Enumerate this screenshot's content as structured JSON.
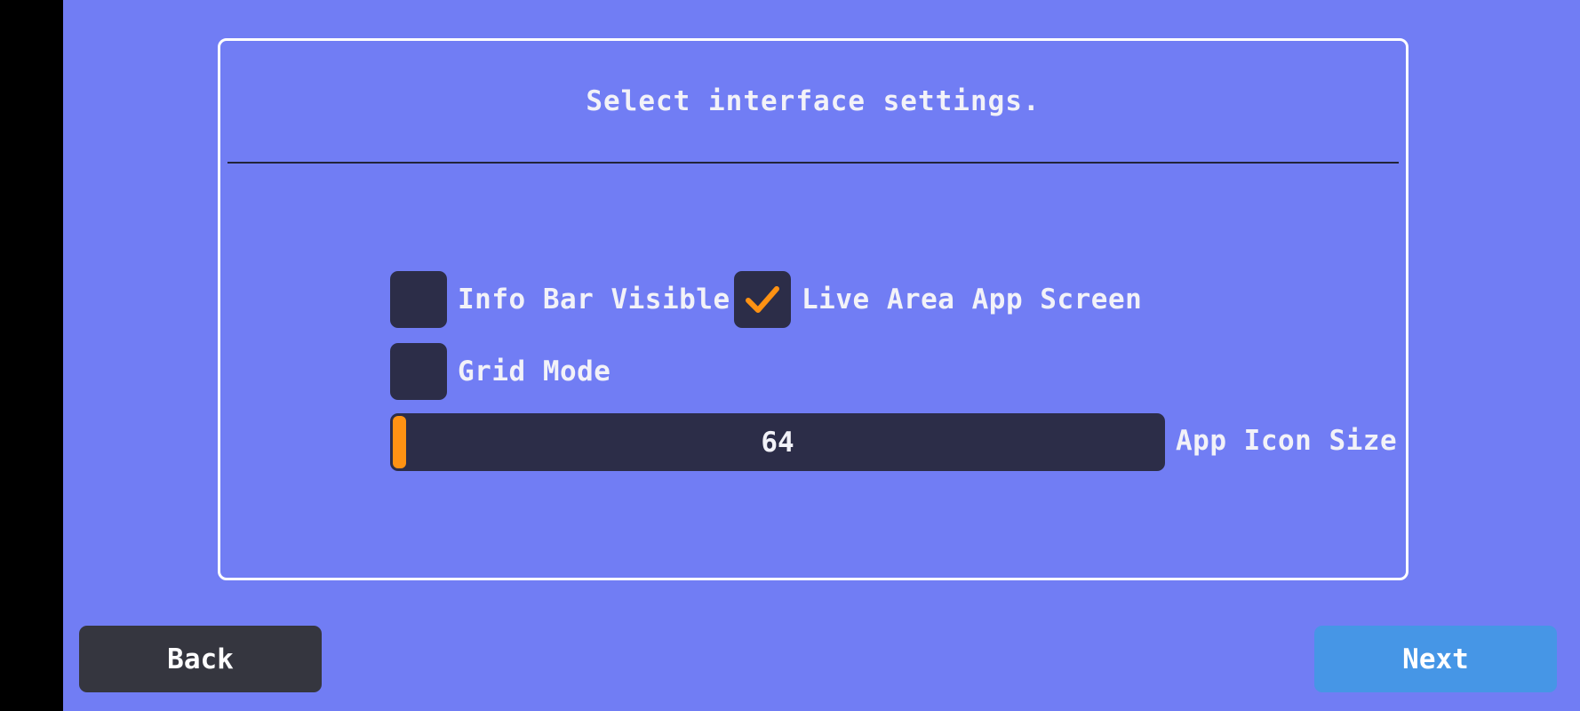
{
  "dialog": {
    "title": "Select interface settings."
  },
  "options": {
    "info_bar": {
      "label": "Info Bar Visible",
      "checked": false
    },
    "live_area": {
      "label": "Live Area App Screen",
      "checked": true
    },
    "grid_mode": {
      "label": "Grid Mode",
      "checked": false
    }
  },
  "icon_size_slider": {
    "value": "64",
    "label": "App Icon Size",
    "fill_fraction": 0.02
  },
  "buttons": {
    "back": "Back",
    "next": "Next"
  },
  "icons": {
    "checkmark": "checkmark-icon"
  },
  "colors": {
    "background": "#717df4",
    "checkbox": "#2c2d48",
    "accent": "#ff9213",
    "back_button": "#35363f",
    "next_button": "#4696e6"
  }
}
